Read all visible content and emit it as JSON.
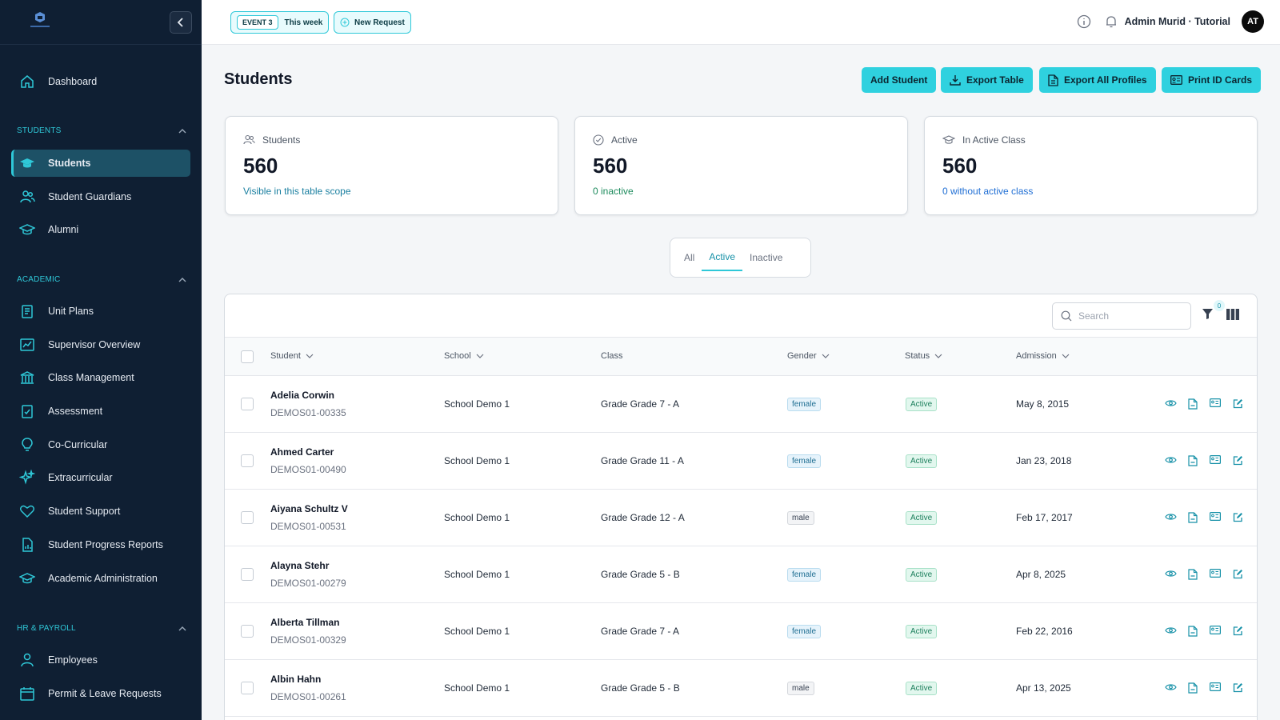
{
  "topbar": {
    "event_chip": "EVENT 3",
    "event_label": "This week",
    "new_request": "New Request",
    "user": "Admin Murid · Tutorial",
    "avatar": "AT"
  },
  "sidebar": {
    "dashboard": "Dashboard",
    "sections": [
      {
        "title": "STUDENTS",
        "items": [
          "Students",
          "Student Guardians",
          "Alumni"
        ]
      },
      {
        "title": "ACADEMIC",
        "items": [
          "Unit Plans",
          "Supervisor Overview",
          "Class Management",
          "Assessment",
          "Co-Curricular",
          "Extracurricular",
          "Student Support",
          "Student Progress Reports",
          "Academic Administration"
        ]
      },
      {
        "title": "HR & PAYROLL",
        "items": [
          "Employees",
          "Permit & Leave Requests"
        ]
      }
    ],
    "active_item": "Students"
  },
  "page": {
    "title": "Students",
    "actions": {
      "add_student": "Add Student",
      "export_table": "Export Table",
      "export_profiles": "Export All Profiles",
      "print_id": "Print ID Cards"
    }
  },
  "cards": [
    {
      "label": "Students",
      "value": "560",
      "sub": "Visible in this table scope",
      "sub_color": "#1a7fa0"
    },
    {
      "label": "Active",
      "value": "560",
      "sub": "0 inactive",
      "sub_color": "#1c8a5c"
    },
    {
      "label": "In Active Class",
      "value": "560",
      "sub": "0 without active class",
      "sub_color": "#1f6ed4"
    }
  ],
  "tabs": {
    "all": "All",
    "active": "Active",
    "inactive": "Inactive"
  },
  "table": {
    "search_placeholder": "Search",
    "filter_count": "0",
    "columns": {
      "student": "Student",
      "school": "School",
      "class": "Class",
      "gender": "Gender",
      "status": "Status",
      "admission": "Admission"
    },
    "rows": [
      {
        "name": "Adelia Corwin",
        "id": "DEMOS01-00335",
        "school": "School Demo 1",
        "class": "Grade Grade 7 - A",
        "gender": "female",
        "status": "Active",
        "admission": "May 8, 2015"
      },
      {
        "name": "Ahmed Carter",
        "id": "DEMOS01-00490",
        "school": "School Demo 1",
        "class": "Grade Grade 11 - A",
        "gender": "female",
        "status": "Active",
        "admission": "Jan 23, 2018"
      },
      {
        "name": "Aiyana Schultz V",
        "id": "DEMOS01-00531",
        "school": "School Demo 1",
        "class": "Grade Grade 12 - A",
        "gender": "male",
        "status": "Active",
        "admission": "Feb 17, 2017"
      },
      {
        "name": "Alayna Stehr",
        "id": "DEMOS01-00279",
        "school": "School Demo 1",
        "class": "Grade Grade 5 - B",
        "gender": "female",
        "status": "Active",
        "admission": "Apr 8, 2025"
      },
      {
        "name": "Alberta Tillman",
        "id": "DEMOS01-00329",
        "school": "School Demo 1",
        "class": "Grade Grade 7 - A",
        "gender": "female",
        "status": "Active",
        "admission": "Feb 22, 2016"
      },
      {
        "name": "Albin Hahn",
        "id": "DEMOS01-00261",
        "school": "School Demo 1",
        "class": "Grade Grade 5 - B",
        "gender": "male",
        "status": "Active",
        "admission": "Apr 13, 2025"
      }
    ]
  },
  "colors": {
    "accent": "#2fd1df",
    "sidebar_bg": "#0f1f33",
    "active_nav": "#1d5166"
  }
}
